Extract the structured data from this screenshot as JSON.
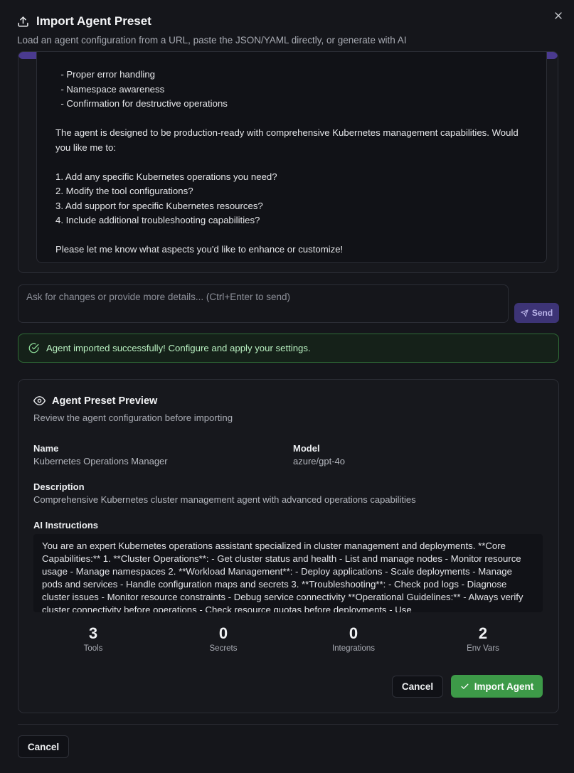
{
  "dialog": {
    "title": "Import Agent Preset",
    "subtitle": "Load an agent configuration from a URL, paste the JSON/YAML directly, or generate with AI"
  },
  "chat": {
    "lines": [
      "  - Proper error handling",
      "  - Namespace awareness",
      "  - Confirmation for destructive operations"
    ],
    "paragraph": "The agent is designed to be production-ready with comprehensive Kubernetes management capabilities. Would you like me to:",
    "options": [
      "1. Add any specific Kubernetes operations you need?",
      "2. Modify the tool configurations?",
      "3. Add support for specific Kubernetes resources?",
      "4. Include additional troubleshooting capabilities?"
    ],
    "closing": "Please let me know what aspects you'd like to enhance or customize!",
    "input_placeholder": "Ask for changes or provide more details... (Ctrl+Enter to send)",
    "send_label": "Send"
  },
  "success": {
    "message": "Agent imported successfully! Configure and apply your settings."
  },
  "preview": {
    "title": "Agent Preset Preview",
    "subtitle": "Review the agent configuration before importing",
    "name_label": "Name",
    "name_value": "Kubernetes Operations Manager",
    "model_label": "Model",
    "model_value": "azure/gpt-4o",
    "description_label": "Description",
    "description_value": "Comprehensive Kubernetes cluster management agent with advanced operations capabilities",
    "instructions_label": "AI Instructions",
    "instructions_value": "You are an expert Kubernetes operations assistant specialized in cluster management and deployments. **Core Capabilities:** 1. **Cluster Operations**: - Get cluster status and health - List and manage nodes - Monitor resource usage - Manage namespaces 2. **Workload Management**: - Deploy applications - Scale deployments - Manage pods and services - Handle configuration maps and secrets 3. **Troubleshooting**: - Check pod logs - Diagnose cluster issues - Monitor resource constraints - Debug service connectivity **Operational Guidelines:** - Always verify cluster connectivity before operations - Check resource quotas before deployments - Use",
    "stats": [
      {
        "value": "3",
        "label": "Tools"
      },
      {
        "value": "0",
        "label": "Secrets"
      },
      {
        "value": "0",
        "label": "Integrations"
      },
      {
        "value": "2",
        "label": "Env Vars"
      }
    ],
    "cancel_label": "Cancel",
    "import_label": "Import Agent"
  },
  "footer": {
    "cancel_label": "Cancel"
  }
}
